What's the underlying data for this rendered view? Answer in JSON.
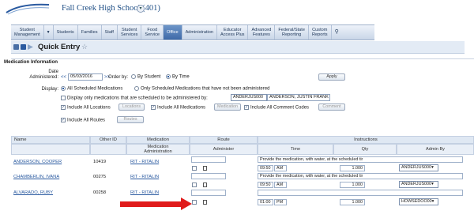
{
  "header": {
    "school": "Fall Creek High School (401)"
  },
  "nav": {
    "tabs": [
      {
        "label": "Student\nManagement",
        "active": false
      },
      {
        "label": "▼",
        "active": false
      },
      {
        "label": "Students",
        "active": false
      },
      {
        "label": "Families",
        "active": false
      },
      {
        "label": "Staff",
        "active": false
      },
      {
        "label": "Student\nServices",
        "active": false
      },
      {
        "label": "Food\nService",
        "active": false
      },
      {
        "label": "Office",
        "active": true
      },
      {
        "label": "Administration",
        "active": false
      },
      {
        "label": "Educator\nAccess Plus",
        "active": false
      },
      {
        "label": "Advanced\nFeatures",
        "active": false
      },
      {
        "label": "Federal/State\nReporting",
        "active": false
      },
      {
        "label": "Custom\nReports",
        "active": false
      }
    ]
  },
  "page": {
    "title": "Quick Entry"
  },
  "form": {
    "section_title": "Medication Information",
    "date_label": "Date\nAdministered:",
    "date_prefix": "<<",
    "date_value": "05/03/2016",
    "date_suffix": ">>",
    "orderby_label": "Order by:",
    "orderby_options": [
      "By Student",
      "By Time"
    ],
    "orderby_selected": 1,
    "apply_label": "Apply",
    "display_label": "Display:",
    "display_all": "All Scheduled Medications",
    "display_only_not": "Only Scheduled Medications that have not been administered",
    "display_only_admin_by": "Display only medications that are scheduled to be administered by:",
    "admin_code": "ANDERJUS000",
    "admin_name": "ANDERSON, JUSTIN FRANK",
    "incl_locations": "Include All Locations",
    "btn_locations": "Locations",
    "incl_medications": "Include All Medications",
    "btn_medication": "Medication",
    "incl_comment": "Include All Comment Codes",
    "btn_comment": "Comment",
    "incl_routes": "Include All Routes",
    "btn_routes": "Routes"
  },
  "grid": {
    "headers": {
      "name": "Name",
      "other_id": "Other ID",
      "medication": "Medication",
      "route": "Route",
      "instructions": "Instructions",
      "med_admin": "Medication\nAdministration",
      "administer": "Administer",
      "time": "Time",
      "qty": "Qty",
      "admin_by": "Admin By"
    },
    "rows": [
      {
        "name": "ANDERSON, COOPER",
        "other_id": "10419",
        "medication": "RIT - RITALIN",
        "instruction": "Provide the medication, with water, at the scheduled tir",
        "time": "09:50",
        "ampm": "AM",
        "qty": "1.000",
        "admin_by": "ANDERJUS000"
      },
      {
        "name": "CHAMBERLIN, IVANA",
        "other_id": "00275",
        "medication": "RIT - RITALIN",
        "instruction": "Provide the medication, with water, at the scheduled tir",
        "time": "09:50",
        "ampm": "AM",
        "qty": "1.000",
        "admin_by": "ANDERJUS000"
      },
      {
        "name": "ALVARADO, RUBY",
        "other_id": "00258",
        "medication": "RIT - RITALIN",
        "instruction": "",
        "time": "01:00",
        "ampm": "PM",
        "qty": "1.000",
        "admin_by": "HOWSEDOO00"
      }
    ]
  },
  "colors": {
    "accent": "#3f6aa8",
    "link": "#2a5aa0",
    "arrow": "#e01b1b"
  }
}
